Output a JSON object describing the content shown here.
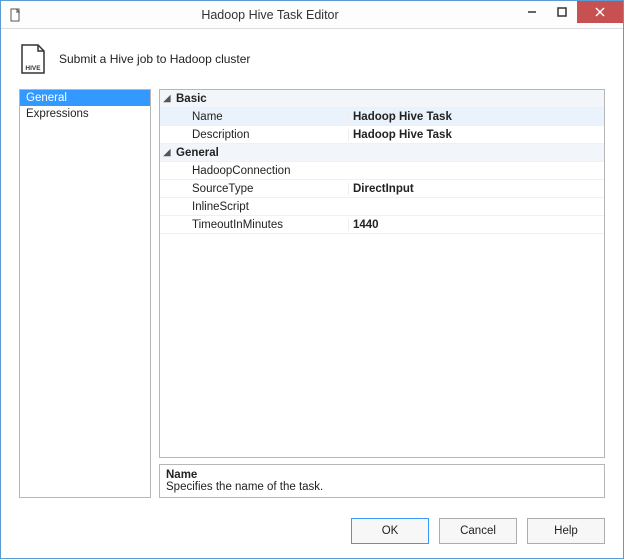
{
  "window": {
    "title": "Hadoop Hive Task Editor",
    "subtitle": "Submit a Hive job to Hadoop cluster"
  },
  "sidebar": {
    "items": [
      {
        "label": "General",
        "active": true
      },
      {
        "label": "Expressions",
        "active": false
      }
    ]
  },
  "propertyGrid": {
    "categories": [
      {
        "label": "Basic",
        "rows": [
          {
            "label": "Name",
            "value": "Hadoop Hive Task",
            "selected": true
          },
          {
            "label": "Description",
            "value": "Hadoop Hive Task"
          }
        ]
      },
      {
        "label": "General",
        "rows": [
          {
            "label": "HadoopConnection",
            "value": ""
          },
          {
            "label": "SourceType",
            "value": "DirectInput"
          },
          {
            "label": "InlineScript",
            "value": ""
          },
          {
            "label": "TimeoutInMinutes",
            "value": "1440"
          }
        ]
      }
    ]
  },
  "descriptionPanel": {
    "title": "Name",
    "text": "Specifies the name of the task."
  },
  "footer": {
    "ok": "OK",
    "cancel": "Cancel",
    "help": "Help"
  }
}
